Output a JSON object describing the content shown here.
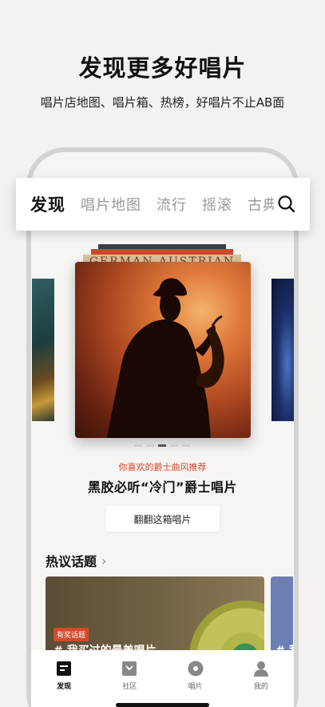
{
  "promo": {
    "headline": "发现更多好唱片",
    "subline": "唱片店地图、唱片箱、热榜，好唱片不止AB面"
  },
  "tabbar": {
    "tabs": [
      {
        "label": "发现",
        "active": true
      },
      {
        "label": "唱片地图",
        "active": false
      },
      {
        "label": "流行",
        "active": false
      },
      {
        "label": "摇滚",
        "active": false
      },
      {
        "label": "古典",
        "active": false
      }
    ],
    "search_icon": "search-icon"
  },
  "carousel": {
    "stack_spine_text": "GERMAN AUSTRIAN",
    "page_count": 5,
    "active_index": 2
  },
  "recommendation": {
    "tag": "你喜欢的爵士曲风推荐",
    "title": "黑胶必听“冷门”爵士唱片",
    "button_label": "翻翻这箱唱片"
  },
  "topics": {
    "header": "热议话题",
    "chevron": "›",
    "cards": [
      {
        "badge": "有奖话题",
        "title": "# 我买过的最美唱片"
      },
      {
        "title": "# 我"
      }
    ]
  },
  "bottom_nav": {
    "items": [
      {
        "label": "发现",
        "icon": "discover-icon",
        "active": true
      },
      {
        "label": "社区",
        "icon": "community-icon",
        "active": false
      },
      {
        "label": "唱片",
        "icon": "record-icon",
        "active": false
      },
      {
        "label": "我的",
        "icon": "profile-icon",
        "active": false
      }
    ]
  },
  "colors": {
    "accent": "#d4492d",
    "background": "#f3f2f0",
    "text_primary": "#111111"
  }
}
